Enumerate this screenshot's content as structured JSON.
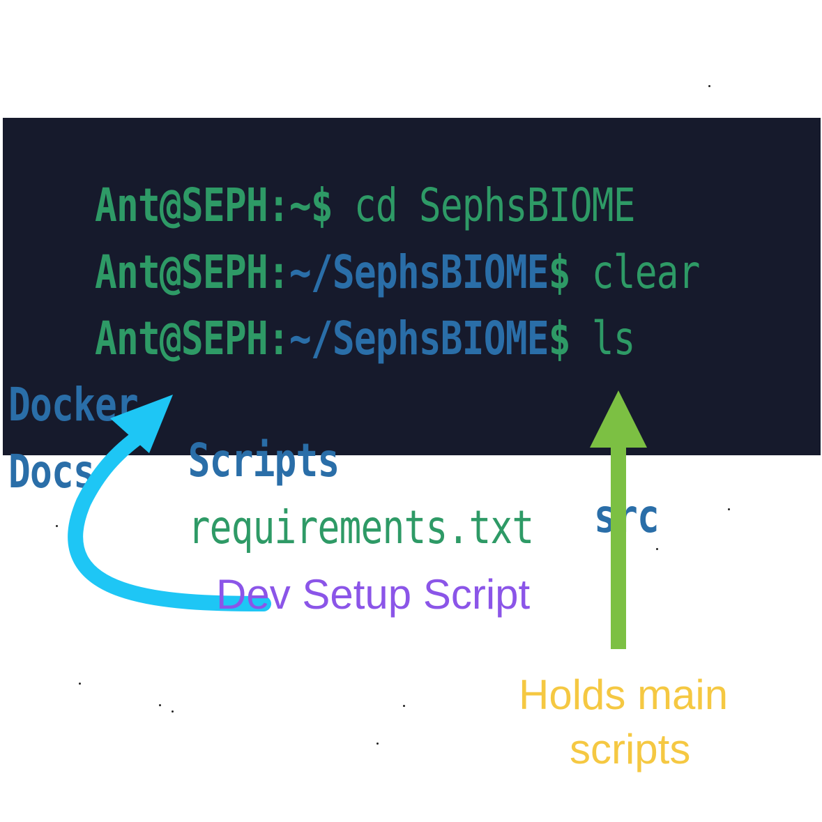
{
  "terminal": {
    "line1": {
      "prompt": "Ant@SEPH",
      "sep": ":",
      "path": "~",
      "dollar": "$",
      "command": " cd SephsBIOME"
    },
    "line2": {
      "prompt": "Ant@SEPH",
      "sep": ":",
      "path": "~/SephsBIOME",
      "dollar": "$",
      "command": " clear"
    },
    "line3": {
      "prompt": "Ant@SEPH",
      "sep": ":",
      "path": "~/SephsBIOME",
      "dollar": "$",
      "command": " ls"
    },
    "listing": {
      "docker": "Docker",
      "scripts": "Scripts",
      "src": "src",
      "docs": "Docs",
      "requirements": "requirements.txt"
    }
  },
  "annotations": {
    "dev_setup": "Dev Setup Script",
    "holds_line1": "Holds main",
    "holds_line2": "scripts"
  },
  "colors": {
    "terminal_bg": "#161a2c",
    "prompt_green": "#2e9a66",
    "dir_blue": "#2a6ea8",
    "arrow_cyan": "#1ec6f5",
    "arrow_green": "#7cc043",
    "dev_label_purple": "#8b55e8",
    "holds_label_yellow": "#f5c842"
  }
}
